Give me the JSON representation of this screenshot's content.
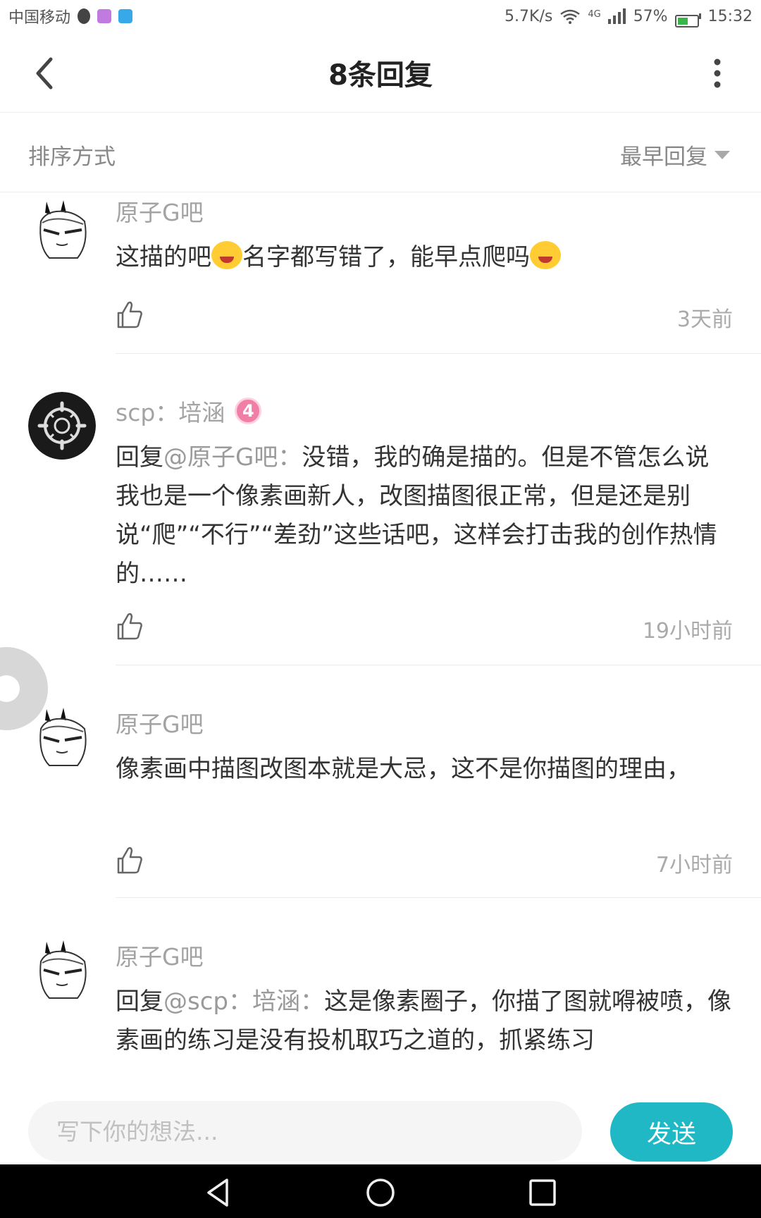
{
  "status_bar": {
    "carrier": "中国移动",
    "net_speed": "5.7K/s",
    "signal_type": "4G",
    "battery": "57%",
    "battery_level": 0.57,
    "time": "15:32",
    "apps": [
      "qq-icon",
      "gallery-icon",
      "message-icon"
    ]
  },
  "header": {
    "title": "8条回复",
    "back_icon": "chevron-left-icon",
    "more_icon": "vertical-dots-icon"
  },
  "sort": {
    "label": "排序方式",
    "selected": "最早回复"
  },
  "comments": [
    {
      "username": "原子G吧",
      "parts": [
        "这描的吧",
        "名字都写错了，能早点爬吗",
        ""
      ],
      "time": "3天前"
    },
    {
      "username": "scp：培涵",
      "badge": "4",
      "reply_prefix": "回复",
      "mention": "@原子G吧：",
      "text": "没错，我的确是描的。但是不管怎么说我也是一个像素画新人，改图描图很正常，但是还是别说“爬”“不行”“差劲”这些话吧，这样会打击我的创作热情的……",
      "time": "19小时前"
    },
    {
      "username": "原子G吧",
      "text": "像素画中描图改图本就是大忌，这不是你描图的理由，",
      "time": "7小时前"
    },
    {
      "username": "原子G吧",
      "reply_prefix": "回复",
      "mention": "@scp：培涵：",
      "text": "这是像素圈子，你描了图就嘚被喷，像素画的练习是没有投机取巧之道的，抓紧练习"
    }
  ],
  "composer": {
    "placeholder": "写下你的想法...",
    "send_label": "发送",
    "accent": "#20b8c4"
  },
  "nav": {
    "icons": [
      "back-triangle-icon",
      "home-circle-icon",
      "recents-square-icon"
    ]
  }
}
